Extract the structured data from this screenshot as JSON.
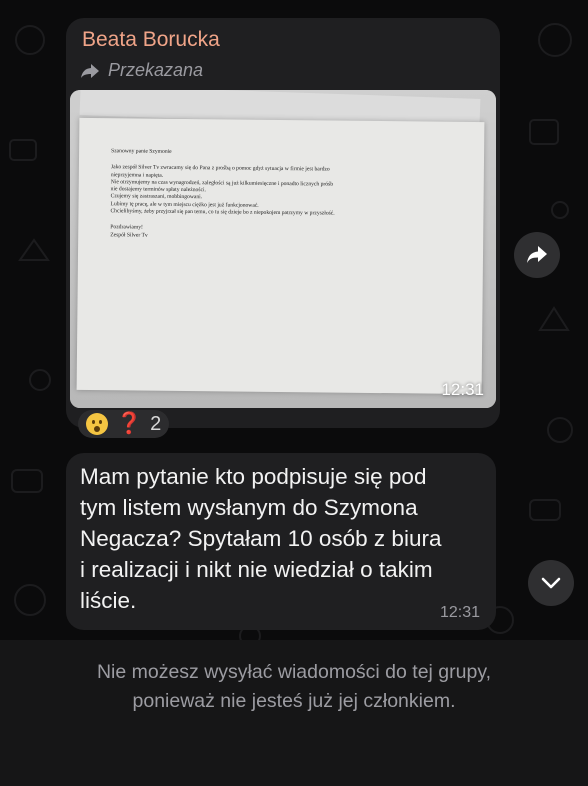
{
  "message1": {
    "sender": "Beata Borucka",
    "forwarded_label": "Przekazana",
    "time": "12:31",
    "letter": {
      "salutation": "Szanowny panie Szymonie",
      "body": [
        "Jako zespół Silver Tv zwracamy się do Pana z prośbą o pomoc gdyż sytuacja w firmie jest bardzo",
        "nieprzyjemna i napięta.",
        "Nie otrzymujemy na czas wynagrodzeń, zaległości są już kilkumiesięczne i ponadto licznych próśb",
        "nie dostajemy terminów spłaty należności.",
        "Czujemy się zastraszani, mobbingowani.",
        "Lubimy tę pracę, ale w tym miejscu ciężko jest już funkcjonować.",
        "Chcielibyśmy, żeby przyjrzał się pan temu, co tu się dzieje bo z niepokojem patrzymy w przyszłość."
      ],
      "closing": [
        "Pozdrawiamy!",
        "Zespół Silver Tv"
      ]
    },
    "reactions": {
      "emoji_icon": "surprised-face-icon",
      "second_icon": "red-question-mark-icon",
      "second_glyph": "❓",
      "count": "2"
    }
  },
  "message2": {
    "lines": [
      "Mam pytanie kto podpisuje się pod",
      "tym listem wysłanym do Szymona",
      "Negacza? Spytałam 10 osób z biura",
      "i realizacji i nikt nie wiedział o takim",
      "liście."
    ],
    "time": "12:31"
  },
  "footer": {
    "notice_lines": [
      "Nie możesz wysyłać wiadomości do tej grupy,",
      "ponieważ nie jesteś już jej członkiem."
    ]
  },
  "colors": {
    "background": "#0b0b0c",
    "bubble": "#1f1f21",
    "sender_name": "#f0a488",
    "footer": "#161617"
  }
}
